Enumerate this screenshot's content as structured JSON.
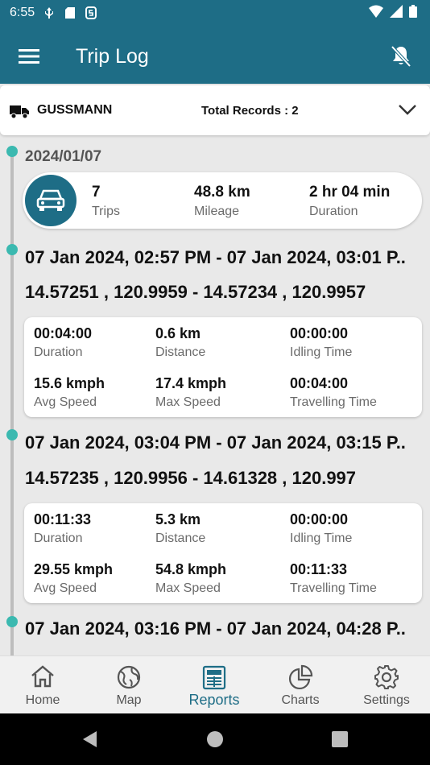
{
  "status_bar": {
    "time": "6:55"
  },
  "app_bar": {
    "title": "Trip Log"
  },
  "vehicle": {
    "name": "GUSSMANN",
    "total_records": "Total Records : 2"
  },
  "day": {
    "date": "2024/01/07",
    "trips_value": "7",
    "trips_label": "Trips",
    "mileage_value": "48.8 km",
    "mileage_label": "Mileage",
    "duration_value": "2 hr 04 min",
    "duration_label": "Duration"
  },
  "trips": [
    {
      "time_range": "07 Jan 2024, 02:57 PM - 07 Jan 2024, 03:01 P..",
      "coords": "14.57251 , 120.9959 - 14.57234 , 120.9957",
      "duration": "00:04:00",
      "distance": "0.6 km",
      "idling": "00:00:00",
      "avg_speed": "15.6 kmph",
      "max_speed": "17.4 kmph",
      "travelling": "00:04:00"
    },
    {
      "time_range": "07 Jan 2024, 03:04 PM - 07 Jan 2024, 03:15 P..",
      "coords": "14.57235 , 120.9956 - 14.61328 , 120.997",
      "duration": "00:11:33",
      "distance": "5.3 km",
      "idling": "00:00:00",
      "avg_speed": "29.55 kmph",
      "max_speed": "54.8 kmph",
      "travelling": "00:11:33"
    },
    {
      "time_range": "07 Jan 2024, 03:16 PM - 07 Jan 2024, 04:28 P.."
    }
  ],
  "labels": {
    "duration": "Duration",
    "distance": "Distance",
    "idling": "Idling Time",
    "avg_speed": "Avg Speed",
    "max_speed": "Max Speed",
    "travelling": "Travelling Time"
  },
  "nav": {
    "home": "Home",
    "map": "Map",
    "reports": "Reports",
    "charts": "Charts",
    "settings": "Settings",
    "active": "reports"
  },
  "colors": {
    "primary": "#1e6d86",
    "accent": "#3bb9b0"
  },
  "icons": [
    "menu-icon",
    "bell-off-icon",
    "truck-icon",
    "chevron-down-icon",
    "car-icon",
    "home-icon",
    "globe-icon",
    "reports-icon",
    "pie-chart-icon",
    "gear-icon"
  ]
}
